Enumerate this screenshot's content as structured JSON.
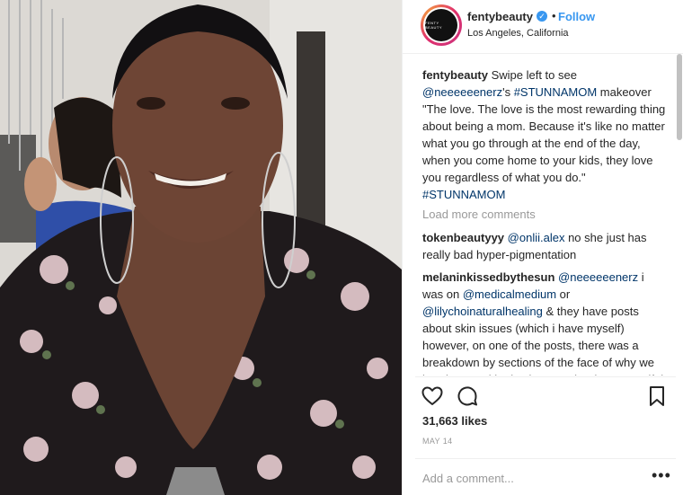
{
  "post": {
    "account": {
      "handle": "fentybeauty",
      "avatar_text": "FENTY BEAUTY",
      "verified_icon": "verified-check-icon",
      "follow_label": "Follow",
      "separator": "•",
      "location": "Los Angeles, California"
    },
    "caption": {
      "user": "fentybeauty",
      "text_before_mention": " Swipe left to see ",
      "mention": "@neeeeeenerz",
      "text_after_mention": "'s ",
      "hashtag_1": "#STUNNAMOM",
      "text_quote": " makeover \"The love. The love is the most rewarding thing about being a mom. Because it's like no matter what you go through at the end of the day, when you come home to your kids, they love you regardless of what you do.\" ",
      "hashtag_2": "#STUNNAMOM"
    },
    "load_more": "Load more comments",
    "comments": [
      {
        "user": "tokenbeautyyy",
        "mention": "@onlii.alex",
        "text": " no she just has really bad hyper-pigmentation"
      },
      {
        "user": "melaninkissedbythesun",
        "mention_1": "@neeeeeenerz",
        "text_1": " i was on ",
        "mention_2": "@medicalmedium",
        "text_2": " or ",
        "mention_3": "@lilychoinaturalhealing",
        "text_3": " & they have posts about skin issues (which i have myself) however, on one of the posts, there was a breakdown by sections of the face of why we breakout & altho ive been to the derm myself, i like how they give insight on"
      }
    ],
    "likes": "31,663 likes",
    "date": "MAY 14",
    "add_comment_placeholder": "Add a comment...",
    "more_label": "•••",
    "icons": {
      "like": "heart-icon",
      "comment": "comment-bubble-icon",
      "save": "bookmark-icon",
      "more": "more-options-icon"
    },
    "colors": {
      "link": "#003569",
      "follow": "#3897f0",
      "muted": "#999999",
      "text": "#262626"
    }
  }
}
